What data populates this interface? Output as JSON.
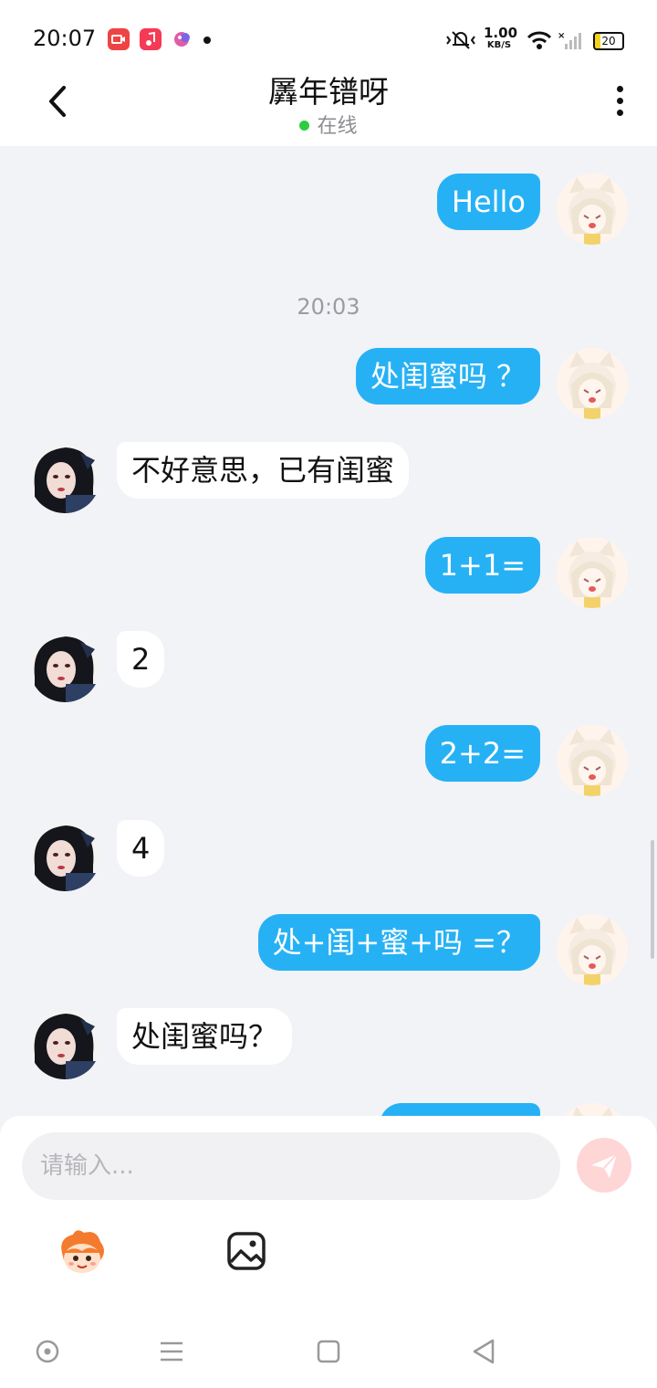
{
  "status_bar": {
    "time": "20:07",
    "net_speed_value": "1.00",
    "net_speed_unit": "KB/S",
    "battery": "20",
    "icons": [
      "screen-record-icon",
      "music-icon",
      "app-icon",
      "notification-dot",
      "mute-icon",
      "wifi-icon",
      "signal-icon",
      "battery-icon"
    ]
  },
  "header": {
    "title": "羼年镨呀",
    "status": "在线",
    "status_color": "#2ecc40"
  },
  "chat": {
    "messages": [
      {
        "side": "me",
        "text": "Hello"
      },
      {
        "timestamp": "20:03"
      },
      {
        "side": "me",
        "text": "处闺蜜吗 ？"
      },
      {
        "side": "other",
        "text": "不好意思，已有闺蜜"
      },
      {
        "side": "me",
        "text": "1+1="
      },
      {
        "side": "other",
        "text": "2"
      },
      {
        "side": "me",
        "text": "2+2="
      },
      {
        "side": "other",
        "text": "4"
      },
      {
        "side": "me",
        "text": "处+闺+蜜+吗 =？"
      },
      {
        "side": "other",
        "text": "处闺蜜吗？"
      }
    ],
    "me_bubble_color": "#27b1f5",
    "other_bubble_color": "#ffffff"
  },
  "composer": {
    "placeholder": "请输入...",
    "value": "",
    "send_color": "#ffd6d6"
  },
  "nav": {
    "icons": [
      "circle-nav-icon",
      "menu-nav-icon",
      "home-nav-icon",
      "back-nav-icon"
    ]
  }
}
